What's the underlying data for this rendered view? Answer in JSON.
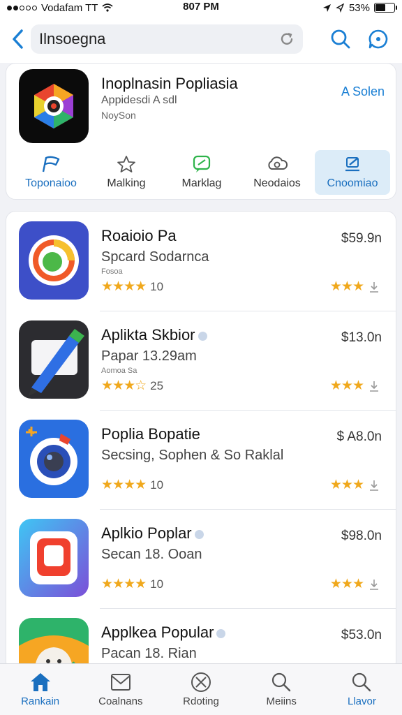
{
  "status_bar": {
    "carrier": "Vodafam TT",
    "time": "807 PM",
    "battery": "53%",
    "battery_level": 0.53
  },
  "search": {
    "query": "Ilnsoegna"
  },
  "featured": {
    "title": "Inoplnasin Popliasia",
    "subtitle": "Appidesdi A sdl",
    "developer": "NoySon",
    "action": "A Solen",
    "icon": "app-icon-colorful"
  },
  "categories": [
    {
      "label": "Toponaioo",
      "icon": "flag-icon"
    },
    {
      "label": "Malking",
      "icon": "star-icon"
    },
    {
      "label": "Marklag",
      "icon": "chat-icon"
    },
    {
      "label": "Neodaios",
      "icon": "cloud-icon"
    },
    {
      "label": "Cnoomiao",
      "icon": "edit-icon"
    }
  ],
  "apps": [
    {
      "name": "Roaioio Pa",
      "subtitle": "Spcard Sodarnca",
      "meta": "Fosoa",
      "stars": "★★★★",
      "rating": "10",
      "price": "$59.9n",
      "right_stars": "★★★",
      "icon": "orange-ring-icon"
    },
    {
      "name": "Aplikta Skbior",
      "subtitle": "Papar 13.29am",
      "meta": "Aomoa Sa",
      "stars": "★★★☆",
      "rating": "25",
      "price": "$13.0n",
      "right_stars": "★★★",
      "icon": "pen-icon"
    },
    {
      "name": "Poplia Bopatie",
      "subtitle": "Secsing, Sophen & So Raklal",
      "meta": "",
      "stars": "★★★★",
      "rating": "10",
      "price": "$ A8.0n",
      "right_stars": "★★★",
      "icon": "camera-icon"
    },
    {
      "name": "Aplkio Poplar",
      "subtitle": "Secan 18. Ooan",
      "meta": "",
      "stars": "★★★★",
      "rating": "10",
      "price": "$98.0n",
      "right_stars": "★★★",
      "icon": "photo-icon"
    },
    {
      "name": "Applkea Popular",
      "subtitle": "Pacan 18. Rian",
      "meta": "",
      "stars": "",
      "rating": "",
      "price": "$53.0n",
      "right_stars": "",
      "icon": "ghost-icon"
    }
  ],
  "tabs": [
    {
      "label": "Rankain",
      "icon": "home-icon",
      "active": true
    },
    {
      "label": "Coalnans",
      "icon": "mail-icon",
      "active": false
    },
    {
      "label": "Rdoting",
      "icon": "cancel-icon",
      "active": false
    },
    {
      "label": "Meiins",
      "icon": "search-icon",
      "active": false
    },
    {
      "label": "Llavor",
      "icon": "search-icon",
      "active": true
    }
  ],
  "colors": {
    "accent": "#1a7fd4",
    "star": "#f0a81c",
    "active_tab_bg": "#dcecf8"
  }
}
